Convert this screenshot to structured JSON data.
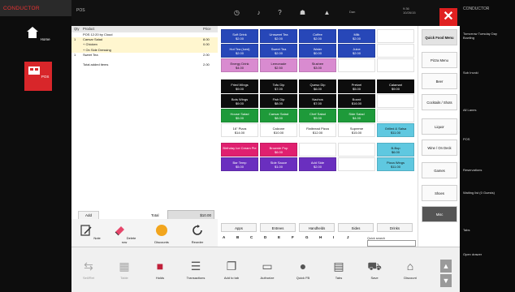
{
  "app": {
    "brand": "CONDUCTOR",
    "screen_label": "POS"
  },
  "left_nav": [
    {
      "label": "Home",
      "icon": "home-icon"
    },
    {
      "label": "POS",
      "icon": "pos-icon"
    }
  ],
  "topbar": {
    "clock_time": "9:36",
    "clock_date": "10/26/15",
    "close_icon": "close-icon",
    "user": "Dan"
  },
  "right_nav": {
    "title": "CONDUCTOR",
    "items": [
      "Tomorrow Tuesday Day Bowling",
      "Sub Invoki",
      "All Lanes",
      "POS",
      "Reservations",
      "Waiting list (0 Guests)",
      "Tabs",
      "Open drawer"
    ]
  },
  "order": {
    "headers": {
      "qty": "Qty",
      "product": "Product",
      "price": "Price"
    },
    "rows": [
      {
        "qty": "",
        "name": "POS 12:20 by Cloud",
        "price": "",
        "highlight": false
      },
      {
        "qty": "1",
        "name": "Caesar Salad",
        "price": "8.00",
        "highlight": true
      },
      {
        "qty": "",
        "name": "+ Chicken",
        "price": "0.00",
        "highlight": true
      },
      {
        "qty": "",
        "name": "+ On Side Dressing",
        "price": "",
        "highlight": true
      },
      {
        "qty": "1",
        "name": "Sweet Tea",
        "price": "2.00",
        "highlight": false
      },
      {
        "qty": "",
        "name": "Total added items",
        "price": "2.00",
        "highlight": false
      }
    ],
    "add_label": "Add",
    "total_label": "Total",
    "total_value": "$10.00"
  },
  "menu_grid": [
    [
      {
        "name": "Soft Drink",
        "price": "$2.00",
        "color": "blue"
      },
      {
        "name": "Unsweet Tea",
        "price": "$2.00",
        "color": "blue"
      },
      {
        "name": "Coffee",
        "price": "$2.00",
        "color": "blue"
      },
      {
        "name": "Milk",
        "price": "$2.00",
        "color": "blue"
      },
      {
        "name": "",
        "price": "",
        "color": "white"
      }
    ],
    [
      {
        "name": "Hot Tea (Iced)",
        "price": "$2.00",
        "color": "blue"
      },
      {
        "name": "Sweet Tea",
        "price": "$2.00",
        "color": "blue"
      },
      {
        "name": "Water",
        "price": "$0.00",
        "color": "blue"
      },
      {
        "name": "Juice",
        "price": "$2.00",
        "color": "blue"
      },
      {
        "name": "",
        "price": "",
        "color": "white"
      }
    ],
    [
      {
        "name": "Energy Drink",
        "price": "$4.00",
        "color": "pink"
      },
      {
        "name": "Lemonade",
        "price": "$2.50",
        "color": "pink"
      },
      {
        "name": "Slushee",
        "price": "$3.00",
        "color": "pink"
      },
      {
        "name": "",
        "price": "",
        "color": "white"
      },
      {
        "name": "",
        "price": "",
        "color": "white"
      }
    ],
    [
      {
        "name": "Fried Wings",
        "price": "$9.00",
        "color": "black"
      },
      {
        "name": "Tofu Dip",
        "price": "$7.00",
        "color": "black"
      },
      {
        "name": "Queso Dip",
        "price": "$6.00",
        "color": "black"
      },
      {
        "name": "Pretzel",
        "price": "$5.00",
        "color": "black"
      },
      {
        "name": "Calamari",
        "price": "$9.00",
        "color": "black"
      }
    ],
    [
      {
        "name": "Bots Wings",
        "price": "$9.00",
        "color": "black"
      },
      {
        "name": "Fish Dip",
        "price": "$8.00",
        "color": "black"
      },
      {
        "name": "Nachos",
        "price": "$7.00",
        "color": "black"
      },
      {
        "name": "Board",
        "price": "$16.00",
        "color": "black"
      },
      {
        "name": "",
        "price": "",
        "color": "white"
      }
    ],
    [
      {
        "name": "House Salad",
        "price": "$5.00",
        "color": "green"
      },
      {
        "name": "Caesar Salad",
        "price": "$8.00",
        "color": "green"
      },
      {
        "name": "Chef Salad",
        "price": "$9.00",
        "color": "green"
      },
      {
        "name": "Side Salad",
        "price": "$4.00",
        "color": "green"
      },
      {
        "name": "",
        "price": "",
        "color": "white"
      }
    ],
    [
      {
        "name": "16\" Pizza",
        "price": "$14.00",
        "color": "white"
      },
      {
        "name": "Calzone",
        "price": "$10.00",
        "color": "white"
      },
      {
        "name": "Flatbread Pizza",
        "price": "$12.00",
        "color": "white"
      },
      {
        "name": "Supreme",
        "price": "$15.00",
        "color": "white"
      },
      {
        "name": "Grilled & Salsa",
        "price": "$11.00",
        "color": "cyan"
      }
    ],
    [
      {
        "name": "Birthday Ice Cream Pie",
        "price": "",
        "color": "mag"
      },
      {
        "name": "Brownie Pop",
        "price": "$6.00",
        "color": "mag"
      },
      {
        "name": "",
        "price": "",
        "color": "white"
      },
      {
        "name": "",
        "price": "",
        "color": "white"
      },
      {
        "name": "B-Bop",
        "price": "$6.00",
        "color": "cyan"
      }
    ],
    [
      {
        "name": "Bar Temp",
        "price": "$5.00",
        "color": "purple"
      },
      {
        "name": "Side Sauce",
        "price": "$1.00",
        "color": "purple"
      },
      {
        "name": "Add Side",
        "price": "$2.00",
        "color": "purple"
      },
      {
        "name": "",
        "price": "",
        "color": "white"
      },
      {
        "name": "Pizza Wings",
        "price": "$11.00",
        "color": "cyan"
      }
    ]
  ],
  "tabs": [
    "Apps",
    "Entrees",
    "Handhelds",
    "Sides",
    "Drinks"
  ],
  "letters": [
    "A",
    "B",
    "C",
    "D",
    "E",
    "F",
    "G",
    "H",
    "I",
    "J"
  ],
  "categories": [
    {
      "label": "Quick Food Menu",
      "style": "sel"
    },
    {
      "label": "Pizza Menu",
      "style": ""
    },
    {
      "label": "Beer",
      "style": ""
    },
    {
      "label": "Cocktails / Shots",
      "style": ""
    },
    {
      "label": "Liquor",
      "style": ""
    },
    {
      "label": "Wine / On Deck",
      "style": ""
    },
    {
      "label": "Games",
      "style": ""
    },
    {
      "label": "Shoes",
      "style": ""
    },
    {
      "label": "Misc",
      "style": "dark"
    }
  ],
  "actions": [
    {
      "label": "Note",
      "icon": "note-icon"
    },
    {
      "label": "Delete row",
      "icon": "eraser-icon"
    },
    {
      "label": "Discounts",
      "icon": "discount-icon"
    },
    {
      "label": "Reorder",
      "icon": "refresh-icon"
    }
  ],
  "search": {
    "label": "Quick search"
  },
  "bottom": [
    {
      "label": "Sell/Ret",
      "icon": "sell-icon",
      "dim": true
    },
    {
      "label": "Table",
      "icon": "table-icon",
      "dim": true
    },
    {
      "label": "Holds",
      "icon": "holds-icon",
      "dim": false
    },
    {
      "label": "Transactions",
      "icon": "receipt-icon",
      "dim": false
    },
    {
      "label": "Add to tab",
      "icon": "copy-icon",
      "dim": false
    },
    {
      "label": "Authorize",
      "icon": "card-icon",
      "dim": false
    },
    {
      "label": "Quick FB",
      "icon": "coin-icon",
      "dim": false
    },
    {
      "label": "Tabs",
      "icon": "register-icon",
      "dim": false
    },
    {
      "label": "Save",
      "icon": "cart-icon",
      "dim": false
    },
    {
      "label": "Discount",
      "icon": "tag-icon",
      "dim": false
    }
  ]
}
